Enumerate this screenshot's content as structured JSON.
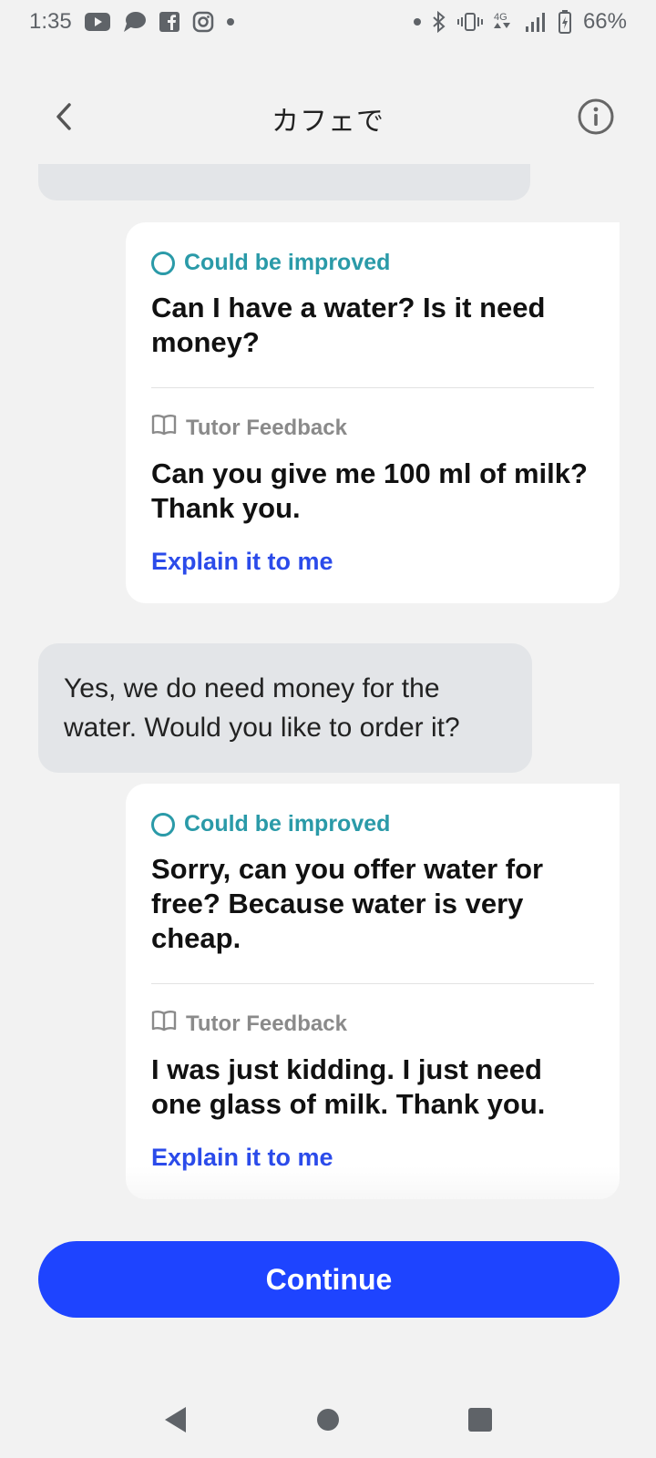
{
  "status_bar": {
    "time": "1:35",
    "battery": "66%",
    "icons": [
      "youtube-icon",
      "chat-icon",
      "facebook-icon",
      "instagram-icon",
      "dot-icon",
      "dot-icon",
      "bluetooth-icon",
      "vibrate-icon",
      "4g-icon",
      "signal-icon",
      "battery-icon"
    ]
  },
  "header": {
    "title": "カフェで",
    "back_icon": "chevron-left-icon",
    "info_icon": "info-icon"
  },
  "messages": [
    {
      "status": "Could be improved",
      "user_text": "Can I have a water? Is it need money?",
      "feedback_label": "Tutor Feedback",
      "feedback_text": "Can you give me 100 ml of milk? Thank you.",
      "explain_label": "Explain it to me"
    },
    {
      "bot_text": "Yes, we do need money for the water. Would you like to order it?"
    },
    {
      "status": "Could be improved",
      "user_text": "Sorry, can you offer water for free? Because water is very cheap.",
      "feedback_label": "Tutor Feedback",
      "feedback_text": "I was just kidding. I just need one glass of milk. Thank you.",
      "explain_label": "Explain it to me"
    }
  ],
  "continue_label": "Continue",
  "colors": {
    "accent": "#1e44ff",
    "status_teal": "#2a9aa8",
    "link_blue": "#2b4bea",
    "background": "#f2f2f2",
    "bot_bubble": "#e3e5e8"
  },
  "nav_bar": {
    "back_icon": "triangle-back-icon",
    "home_icon": "circle-home-icon",
    "recents_icon": "square-recents-icon"
  }
}
